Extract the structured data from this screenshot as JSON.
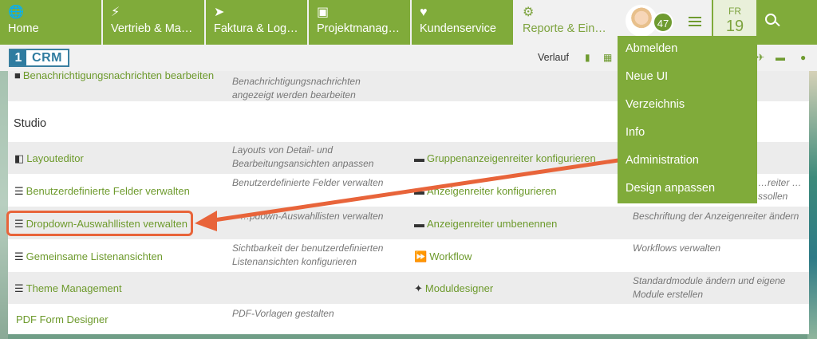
{
  "nav": {
    "tabs": [
      {
        "label": "Home",
        "icon": "globe-icon"
      },
      {
        "label": "Vertrieb & Mar…",
        "icon": "lightning-icon"
      },
      {
        "label": "Faktura & Logis…",
        "icon": "paper-plane-icon"
      },
      {
        "label": "Projektmanage…",
        "icon": "box-icon"
      },
      {
        "label": "Kundenservice",
        "icon": "heart-icon"
      },
      {
        "label": "Reporte & Eins…",
        "icon": "gear-icon"
      }
    ],
    "notification_count": "47",
    "date_dow": "FR",
    "date_day": "19"
  },
  "subbar": {
    "logo_one": "1",
    "logo_crm": "CRM",
    "history_label": "Verlauf"
  },
  "panel": {
    "top_row": {
      "link": "Benachrichtigungsnachrichten bearbeiten",
      "desc": "Benachrichtigungsnachrichten angezeigt werden bearbeiten"
    },
    "section_title": "Studio",
    "rows": [
      {
        "left_link": "Layouteditor",
        "left_desc": "Layouts von Detail- und Bearbeitungsansichten anpassen",
        "right_link": "Gruppenanzeigenreiter konfigurieren",
        "right_desc": ""
      },
      {
        "left_link": "Benutzerdefinierte Felder verwalten",
        "left_desc": "Benutzerdefinierte Felder verwalten",
        "right_link": "Anzeigenreiter konfigurieren",
        "right_desc": "…reiter …ssollen"
      },
      {
        "left_link": "Dropdown-Auswahllisten verwalten",
        "left_desc": "…pdown-Auswahllisten verwalten",
        "right_link": "Anzeigenreiter umbenennen",
        "right_desc": "Beschriftung der Anzeigenreiter ändern"
      },
      {
        "left_link": "Gemeinsame Listenansichten",
        "left_desc": "Sichtbarkeit der benutzerdefinierten Listenansichten konfigurieren",
        "right_link": "Workflow",
        "right_desc": "Workflows verwalten"
      },
      {
        "left_link": "Theme Management",
        "left_desc": "",
        "right_link": "Moduldesigner",
        "right_desc": "Standardmodule ändern und eigene Module erstellen"
      },
      {
        "left_link": "PDF Form Designer",
        "left_desc": "PDF-Vorlagen gestalten",
        "right_link": "",
        "right_desc": ""
      }
    ]
  },
  "dropdown": {
    "items": [
      "Abmelden",
      "Neue UI",
      "Verzeichnis",
      "Info",
      "Administration",
      "Design anpassen"
    ]
  },
  "colors": {
    "brand_green": "#80ab3a",
    "link_green": "#6d9a2c",
    "annotation_orange": "#e8643a"
  }
}
